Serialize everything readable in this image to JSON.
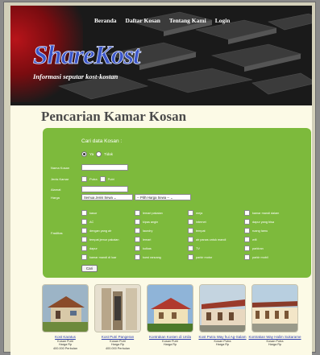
{
  "nav": [
    "Beranda",
    "Daftar Kosan",
    "Tentang Kami",
    "Login"
  ],
  "logo": {
    "title": "ShareKost",
    "subtitle": "Informasi seputar kost-kostan"
  },
  "page_title": "Pencarian Kamar Kosan",
  "search": {
    "heading": "Cari data Kosan :",
    "radio_options": [
      "Ya",
      "Tidak"
    ],
    "labels": {
      "nama": "Nama Kosan",
      "jenis": "Jenis Kamar",
      "alamat": "Alamat",
      "harga": "Harga",
      "fasilitas": "Fasilitas"
    },
    "gender_options": [
      "Putra",
      "Putri"
    ],
    "type_select": "Semua Jenis Sewa",
    "price_select": "-- Pilih Harga Sewa --",
    "facilities": [
      [
        "kasur",
        "lemari pakaian",
        "meja",
        "kamar mandi dalam"
      ],
      [
        "AC",
        "kipas angin",
        "internet",
        "dapur yang bisa"
      ],
      [
        "dengan yang air",
        "laundry",
        "tempat",
        "ruang tamu"
      ],
      [
        "tempat jemur pakaian",
        "lemari",
        "air panas untuk mandi",
        "wifi"
      ],
      [
        "dapur",
        "kulkas",
        "TV",
        "parkiran"
      ],
      [
        "kamar mandi di luar",
        "kursi rancang",
        "parkir motor",
        "parkir mobil"
      ]
    ],
    "submit": "Cari"
  },
  "listings": [
    {
      "name": "Kost Karatus",
      "type": "Kosan Putri",
      "price": "Harga Rp",
      "extra": "400.000 Perbulan"
    },
    {
      "name": "Kost Putri Pangeran",
      "type": "Kosan Putri",
      "price": "Harga Rp",
      "extra": "400.000 Perbulan"
    },
    {
      "name": "Kontrakan Kosten di Unila",
      "type": "Kosan Putri",
      "price": "Harga Rp",
      "extra": ""
    },
    {
      "name": "Kost Putra Way hui Ag-Salam",
      "type": "Kosan Putra",
      "price": "Harga Rp",
      "extra": ""
    },
    {
      "name": "Kontrakan Way Halim Sukarame",
      "type": "Kosan Putra",
      "price": "Harga Rp",
      "extra": ""
    }
  ]
}
